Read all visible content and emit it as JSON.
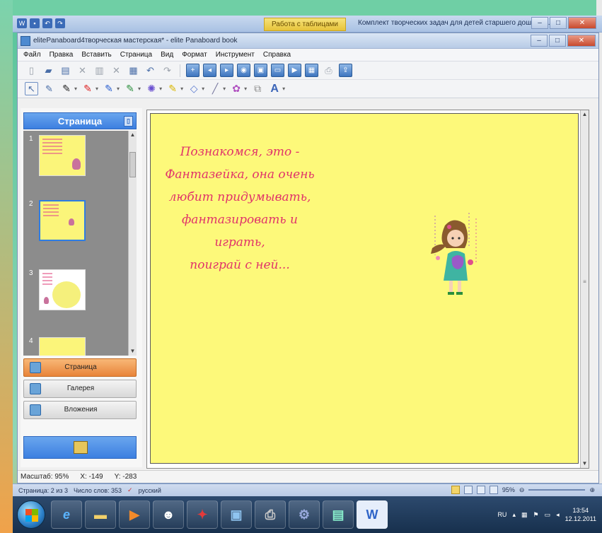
{
  "word": {
    "contextual_tab": "Работа с таблицами",
    "title": "Комплект творческих задач для детей старшего дошколь..."
  },
  "panaboard": {
    "title": "elitePanaboard4творческая мастерская* - elite Panaboard book",
    "menu": [
      "Файл",
      "Правка",
      "Вставить",
      "Страница",
      "Вид",
      "Формат",
      "Инструмент",
      "Справка"
    ],
    "toolbar1": [
      "new-page-icon",
      "open-icon",
      "save-icon",
      "cut-icon",
      "copy-icon",
      "delete-icon",
      "paste-icon",
      "undo-icon",
      "redo-icon",
      "insert-page-icon",
      "prev-page-icon",
      "next-page-icon",
      "camera-icon",
      "image-icon",
      "screen-icon",
      "video-icon",
      "gallery-icon",
      "print-icon",
      "export-icon"
    ],
    "toolbar2": [
      "select-icon",
      "eraser-icon",
      "pen-black-icon",
      "pen-red-icon",
      "pen-blue-icon",
      "pen-green-icon",
      "fill-icon",
      "highlighter-icon",
      "shape-icon",
      "line-icon",
      "color-icon",
      "group-icon",
      "text-icon"
    ]
  },
  "side_panel": {
    "header": "Страница",
    "pages": [
      "1",
      "2",
      "3",
      "4"
    ],
    "selected_page": 2,
    "buttons": [
      {
        "label": "Страница",
        "active": true
      },
      {
        "label": "Галерея",
        "active": false
      },
      {
        "label": "Вложения",
        "active": false
      }
    ]
  },
  "canvas": {
    "text_lines": [
      "Познакомся, это -",
      "Фантазейка, она очень",
      "любит придумывать,",
      "фантазировать и играть,",
      "поиграй с ней..."
    ],
    "background": "#fdf97a",
    "text_color": "#e0336a"
  },
  "status": {
    "zoom": "Масштаб: 95%",
    "x": "X: -149",
    "y": "Y: -283"
  },
  "word_status": {
    "page": "Страница: 2 из 3",
    "words": "Число слов: 353",
    "language": "русский",
    "zoom": "95%"
  },
  "taskbar": {
    "lang": "RU",
    "time": "13:54",
    "date": "12.12.2011"
  }
}
